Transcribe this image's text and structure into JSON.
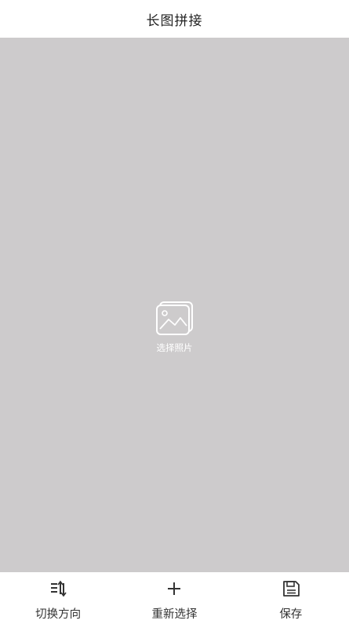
{
  "header": {
    "title": "长图拼接"
  },
  "canvas": {
    "background": "#cdcbcc",
    "picker": {
      "icon": "image-gallery-icon",
      "label": "选择照片"
    }
  },
  "bottom_bar": {
    "buttons": [
      {
        "icon": "switch-direction-icon",
        "label": "切换方向"
      },
      {
        "icon": "plus-icon",
        "label": "重新选择"
      },
      {
        "icon": "save-floppy-icon",
        "label": "保存"
      }
    ]
  }
}
